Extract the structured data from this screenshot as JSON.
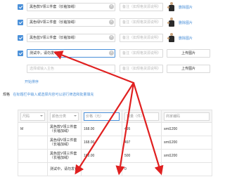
{
  "variant_rows": [
    {
      "checked": true,
      "name": "黑色款V领三件套（长袖加绒）",
      "name_placeholder": "",
      "remark_placeholder": "备注（如规格货源说明）",
      "action": "image",
      "link_label": "删除图片"
    },
    {
      "checked": true,
      "name": "黑色绿V领三件套（长袖加绒）",
      "name_placeholder": "",
      "remark_placeholder": "备注（如规格货源说明）",
      "action": "image",
      "link_label": "删除图片"
    },
    {
      "checked": true,
      "name": "黑色蓝V领三件套（长袖加绒）",
      "name_placeholder": "",
      "remark_placeholder": "备注（如规格货源说明）",
      "action": "image",
      "link_label": "删除图片"
    },
    {
      "checked": true,
      "name": "测试中，请勿发布",
      "name_placeholder": "",
      "remark_placeholder": "备注（如规格货源说明）",
      "action": "upload",
      "upload_label": "上传图片"
    },
    {
      "checked": false,
      "name": "",
      "name_placeholder": "选择或输入主色",
      "remark_placeholder": "备注（如规格货源说明）",
      "action": "upload",
      "upload_label": "上传图片"
    }
  ],
  "sort_label": "开始排序",
  "spec": {
    "label": "规格",
    "hint": "在标题栏中输入或选择内容可以进行筛选和批量填充"
  },
  "table": {
    "header": {
      "size": "尺码",
      "color": "颜色分类",
      "price": "价格（元）",
      "qty": "数量（件）",
      "code": "商家编码"
    },
    "rows": [
      {
        "size": "M",
        "color": "黑色款V领三件套（长袖加绒）",
        "price": "168.00",
        "qty": "495",
        "code": "smt1200"
      },
      {
        "size": "",
        "color": "黑色绿V领三件套（长袖加绒）",
        "price": "168.00",
        "qty": "497",
        "code": "smt1200"
      },
      {
        "size": "",
        "color": "黑色蓝V领三件套（长袖加绒）",
        "price": "168.00",
        "qty": "500",
        "code": "smt1200"
      },
      {
        "size": "",
        "color": "测试中，请勿发布",
        "price": "",
        "qty": "0",
        "code": ""
      }
    ]
  },
  "colors": {
    "accent": "#4a90d9",
    "annotation_arrow": "#e02020"
  }
}
